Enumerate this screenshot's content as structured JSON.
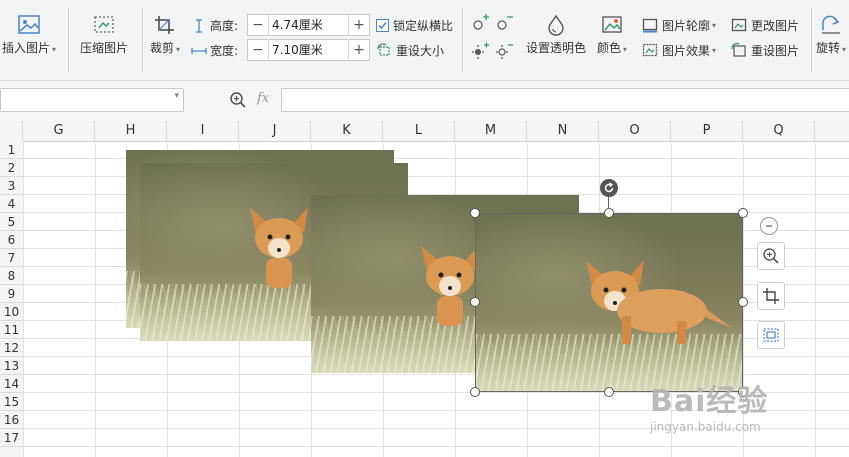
{
  "ribbon": {
    "insert_picture": "插入图片",
    "compress_picture": "压缩图片",
    "crop": "裁剪",
    "height_label": "高度:",
    "height_value": "4.74厘米",
    "width_label": "宽度:",
    "width_value": "7.10厘米",
    "lock_ratio": "锁定纵横比",
    "lock_ratio_checked": true,
    "reset_size": "重设大小",
    "set_transparent": "设置透明色",
    "color": "颜色",
    "picture_outline": "图片轮廓",
    "picture_effect": "图片效果",
    "change_picture": "更改图片",
    "reset_picture": "重设图片",
    "rotate": "旋转",
    "minus": "−",
    "plus": "+"
  },
  "formula_bar": {
    "fx": "fx"
  },
  "columns": [
    "G",
    "H",
    "I",
    "J",
    "K",
    "L",
    "M",
    "N",
    "O",
    "P",
    "Q"
  ],
  "rows": [
    "1",
    "2",
    "3",
    "4",
    "5",
    "6",
    "7",
    "8",
    "9",
    "10",
    "11",
    "12",
    "13",
    "14",
    "15",
    "16",
    "17"
  ],
  "watermark": {
    "brand": "Bai经验",
    "url": "jingyan.baidu.com"
  },
  "colors": {
    "accent": "#4a86c8",
    "icon_green": "#2e9a5e",
    "ribbon_bg": "#f3f4f6"
  }
}
